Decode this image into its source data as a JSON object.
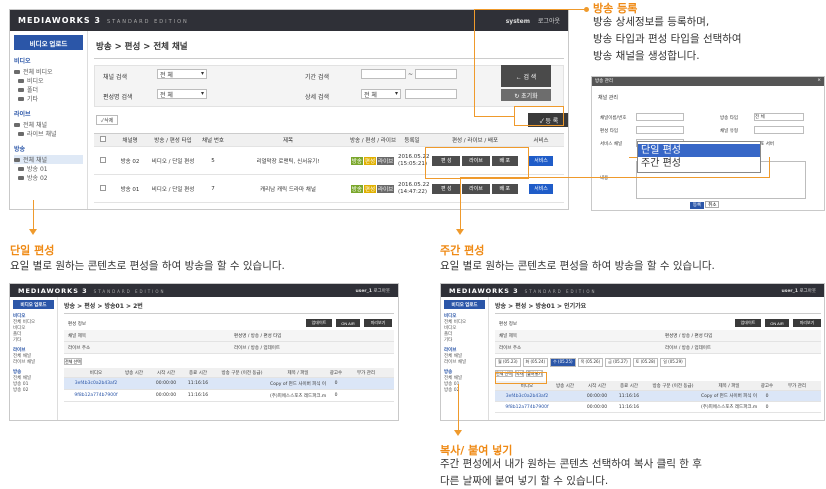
{
  "main_screen": {
    "brand": "MEDIAWORKS 3",
    "edition": "STANDARD EDITION",
    "user": "system",
    "logout": "로그아웃",
    "upload_button": "비디오 업로드",
    "sidebar": [
      {
        "section": "비디오",
        "items": [
          "전체 비디오",
          "비디오",
          "폴더",
          "기타"
        ]
      },
      {
        "section": "라이브",
        "items": [
          "전체 채널",
          "라이브 채널"
        ]
      },
      {
        "section": "방송",
        "items": [
          "전체 채널",
          "방송 01",
          "방송 02"
        ]
      }
    ],
    "breadcrumb": "방송 > 편성 > 전체 채널",
    "filters": {
      "channel_label": "채널 검색",
      "channel_value": "전 체",
      "period_label": "기간 검색",
      "period_sep": "~",
      "org_label": "편성명 검색",
      "org_value": "전 체",
      "detail_label": "상세 검색",
      "detail_value": "전 체",
      "search_button": "검 색",
      "reset_button": "초기화"
    },
    "register_button": "등 록",
    "delete_button": "삭제",
    "table_headers": [
      "채널명",
      "방송 / 편성 타입",
      "채널 번호",
      "제목",
      "방송 / 편성 / 라이브",
      "등록일",
      "편성 / 라이브 / 배포",
      "서비스"
    ],
    "rows": [
      {
        "channel": "방송 02",
        "type": "비디오 / 단일 편성",
        "num": "5",
        "title": "리얼막장 로맨틱, 신서유기!",
        "date": "2016.05.22",
        "time": "(15:05:21)",
        "edit": "편 성",
        "live": "라이브",
        "dist": "배 포",
        "service": "서비스"
      },
      {
        "channel": "방송 01",
        "type": "비디오 / 단일 편성",
        "num": "7",
        "title": "캐리남 캐릭 드라마 채널",
        "date": "2016.05.22",
        "time": "(14:47:22)",
        "edit": "편 성",
        "live": "라이브",
        "dist": "배 포",
        "service": "서비스"
      }
    ],
    "status_tags": [
      "방송",
      "편성",
      "라이브"
    ],
    "status_colors": [
      "#7aa72c",
      "#e0b000",
      "#6a6a6a"
    ]
  },
  "dialog_screen": {
    "title": "방송 관리",
    "section": "채널 관리",
    "labels": [
      "채널이름/번호",
      "방송 타입",
      "편성 타입",
      "채널 유형",
      "서비스 채널",
      "배포 서버",
      "내용"
    ],
    "select_value": "전 체",
    "options": [
      "단일 편성",
      "주간 편성"
    ],
    "ok_button": "등록",
    "cancel_button": "취소"
  },
  "single_screen": {
    "brand": "MEDIAWORKS 3",
    "edition": "STANDARD EDITION",
    "user": "user_1",
    "logout": "로그아웃",
    "upload_button": "비디오 업로드",
    "breadcrumb": "방송 > 편성 > 방송01 > 2번",
    "info_label": "편성 정보",
    "buttons": [
      "업데이트",
      "ON AIR",
      "미리보기"
    ],
    "row_labels": [
      "채널 제목",
      "라이브 주소"
    ],
    "row_right_labels": [
      "편성명 / 방송 / 편성 타입",
      "라이브 / 방송 / 업데이트"
    ],
    "table_headers": [
      "비디오",
      "방송 시간",
      "시작 시간",
      "종료 시간",
      "방송 구분 (이전 동급)",
      "제목 / 파일",
      "광고수",
      "부가 관리"
    ],
    "list_rows": [
      {
        "id": "3ef4b3c0a2b43af2",
        "start": "00:00:00",
        "end": "11:16:16",
        "title": "Copy of 펀드 사이버 피식 이야기",
        "ad": "0"
      },
      {
        "id": "9f8b12a774b7900f",
        "start": "00:00:00",
        "end": "11:16:16",
        "title": "(주)피에스스포츠 레드파크.mp4",
        "ad": "0"
      }
    ]
  },
  "weekly_screen": {
    "brand": "MEDIAWORKS 3",
    "edition": "STANDARD EDITION",
    "user": "user_1",
    "logout": "로그아웃",
    "upload_button": "비디오 업로드",
    "breadcrumb": "방송 > 편성 > 방송01 > 인기가요",
    "info_label": "편성 정보",
    "buttons": [
      "업데이트",
      "ON AIR",
      "미리보기"
    ],
    "day_tabs": [
      "월 (05.23)",
      "화 (05.24)",
      "수 (05.25)",
      "목 (05.26)",
      "금 (05.27)",
      "토 (05.28)",
      "일 (05.29)"
    ],
    "copy_buttons": [
      "전체 선택",
      "복사",
      "붙여넣기"
    ],
    "table_headers": [
      "비디오",
      "방송 시간",
      "시작 시간",
      "종료 시간",
      "방송 구분 (이전 동급)",
      "제목 / 파일",
      "광고수",
      "부가 관리"
    ],
    "list_rows": [
      {
        "id": "3ef4b3c0a2b43af2",
        "start": "00:00:00",
        "end": "11:16:16",
        "title": "Copy of 펀드 사이버 피식 이야기",
        "ad": "0"
      },
      {
        "id": "9f8b12a774b7900f",
        "start": "00:00:00",
        "end": "11:16:16",
        "title": "(주)피에스스포츠 레드파크.mp4",
        "ad": "0"
      }
    ]
  },
  "annotations": {
    "register_title": "방송 등록",
    "register_body": [
      "방송 상세정보를 등록하며,",
      "방송 타입과 편성 타입을 선택하여",
      "방송 채널을 생성합니다."
    ],
    "single_title": "단일 편성",
    "single_body": "요일 별로 원하는 콘텐츠로 편성을 하여 방송을 할 수 있습니다.",
    "weekly_title": "주간 편성",
    "weekly_body": "요일 별로 원하는 콘텐츠로 편성을 하여 방송을 할 수 있습니다.",
    "copy_title": "복사/ 붙여 넣기",
    "copy_body": [
      "주간 편성에서 내가 원하는 콘텐츠 선택하여 복사 클릭 한 후",
      "다른 날짜에 붙여 넣기 할 수 있습니다."
    ]
  },
  "accent_color": "#ef9a2c"
}
